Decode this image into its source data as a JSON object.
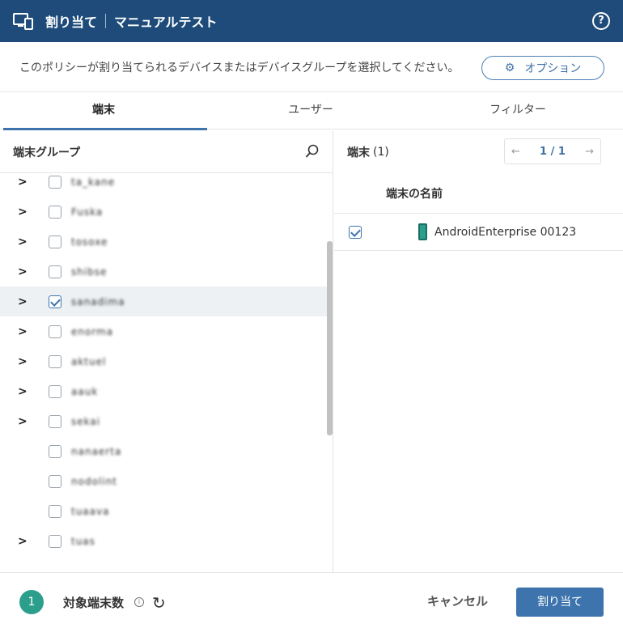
{
  "header": {
    "title": "割り当て",
    "subtitle": "マニュアルテスト",
    "help_icon": "question-circle-icon"
  },
  "instruction": {
    "text": "このポリシーが割り当てられるデバイスまたはデバイスグループを選択してください。",
    "options_label": "オプション"
  },
  "tabs": [
    {
      "label": "端末",
      "active": true
    },
    {
      "label": "ユーザー",
      "active": false
    },
    {
      "label": "フィルター",
      "active": false
    }
  ],
  "left": {
    "title": "端末グループ",
    "groups": [
      {
        "name": "ta_kane",
        "expandable": true,
        "checked": false
      },
      {
        "name": "Fuska",
        "expandable": true,
        "checked": false
      },
      {
        "name": "tosoxe",
        "expandable": true,
        "checked": false
      },
      {
        "name": "shibse",
        "expandable": true,
        "checked": false
      },
      {
        "name": "sanadima",
        "expandable": true,
        "checked": true
      },
      {
        "name": "enorma",
        "expandable": true,
        "checked": false
      },
      {
        "name": "aktuel",
        "expandable": true,
        "checked": false
      },
      {
        "name": "aauk",
        "expandable": true,
        "checked": false
      },
      {
        "name": "sekai",
        "expandable": true,
        "checked": false
      },
      {
        "name": "nanaerta",
        "expandable": false,
        "checked": false
      },
      {
        "name": "nodolint",
        "expandable": false,
        "checked": false
      },
      {
        "name": "tuaava",
        "expandable": false,
        "checked": false
      },
      {
        "name": "tuas",
        "expandable": true,
        "checked": false
      }
    ]
  },
  "right": {
    "title": "端末",
    "count": "(1)",
    "pager": {
      "prev": "←",
      "page": "1 / 1",
      "next": "→"
    },
    "column_header": "端末の名前",
    "devices": [
      {
        "name": "AndroidEnterprise 00123",
        "checked": true
      }
    ]
  },
  "footer": {
    "count": "1",
    "count_label": "対象端末数",
    "cancel_label": "キャンセル",
    "assign_label": "割り当て"
  }
}
